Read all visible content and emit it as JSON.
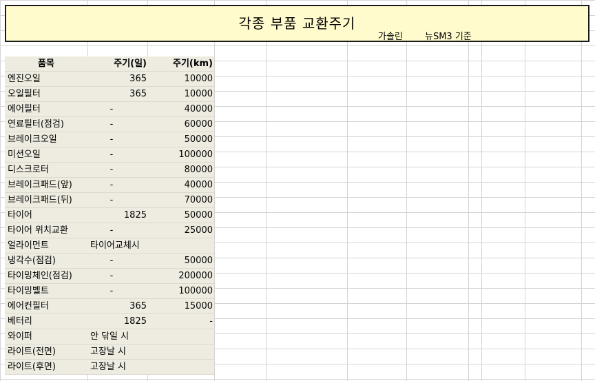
{
  "sheet": {
    "title": "각종 부품 교환주기",
    "subtitle_fuel": "가솔린",
    "subtitle_model": "뉴SM3 기준",
    "headers": [
      "품목",
      "주기(일)",
      "주기(km)"
    ],
    "rows": [
      [
        "엔진오일",
        "365",
        "10000"
      ],
      [
        "오일필터",
        "365",
        "10000"
      ],
      [
        "에어필터",
        "-",
        "40000"
      ],
      [
        "연료필터(점검)",
        "-",
        "60000"
      ],
      [
        "브레이크오일",
        "-",
        "50000"
      ],
      [
        "미션오일",
        "-",
        "100000"
      ],
      [
        "디스크로터",
        "-",
        "80000"
      ],
      [
        "브레이크패드(앞)",
        "-",
        "40000"
      ],
      [
        "브레이크패드(뒤)",
        "-",
        "70000"
      ],
      [
        "타이어",
        "1825",
        "50000"
      ],
      [
        "타이어 위치교환",
        "-",
        "25000"
      ],
      [
        "얼라이먼트",
        "타이어교체시",
        ""
      ],
      [
        "냉각수(점검)",
        "-",
        "50000"
      ],
      [
        "타이밍체인(점검)",
        "-",
        "200000"
      ],
      [
        "타이밍벨트",
        "-",
        "100000"
      ],
      [
        "에어컨필터",
        "365",
        "15000"
      ],
      [
        "베터리",
        "1825",
        "-"
      ],
      [
        "와이퍼",
        "안 닦일 시",
        ""
      ],
      [
        "라이트(전면)",
        "고장날 시",
        ""
      ],
      [
        "라이트(후면)",
        "고장날 시",
        ""
      ]
    ]
  }
}
